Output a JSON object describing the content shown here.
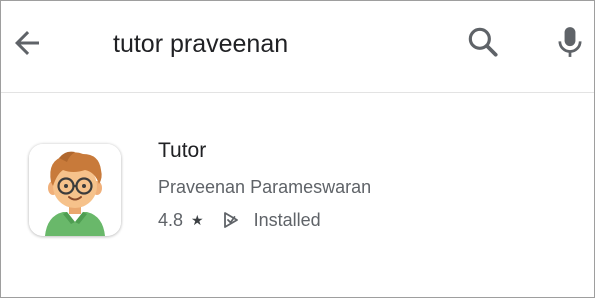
{
  "search": {
    "query": "tutor praveenan",
    "back_icon": "arrow-left-icon",
    "search_icon": "search-icon",
    "mic_icon": "microphone-icon"
  },
  "result": {
    "title": "Tutor",
    "developer": "Praveenan Parameswaran",
    "rating": "4.8",
    "rating_icon": "star-icon",
    "status": "Installed",
    "status_icon": "installed-icon",
    "app_icon": "tutor-avatar-icon"
  },
  "colors": {
    "text_primary": "#202124",
    "text_secondary": "#5f6368",
    "icon_gray": "#5f6368",
    "hair": "#c87a3a",
    "skin": "#f6c28b",
    "shirt": "#69b86a"
  }
}
